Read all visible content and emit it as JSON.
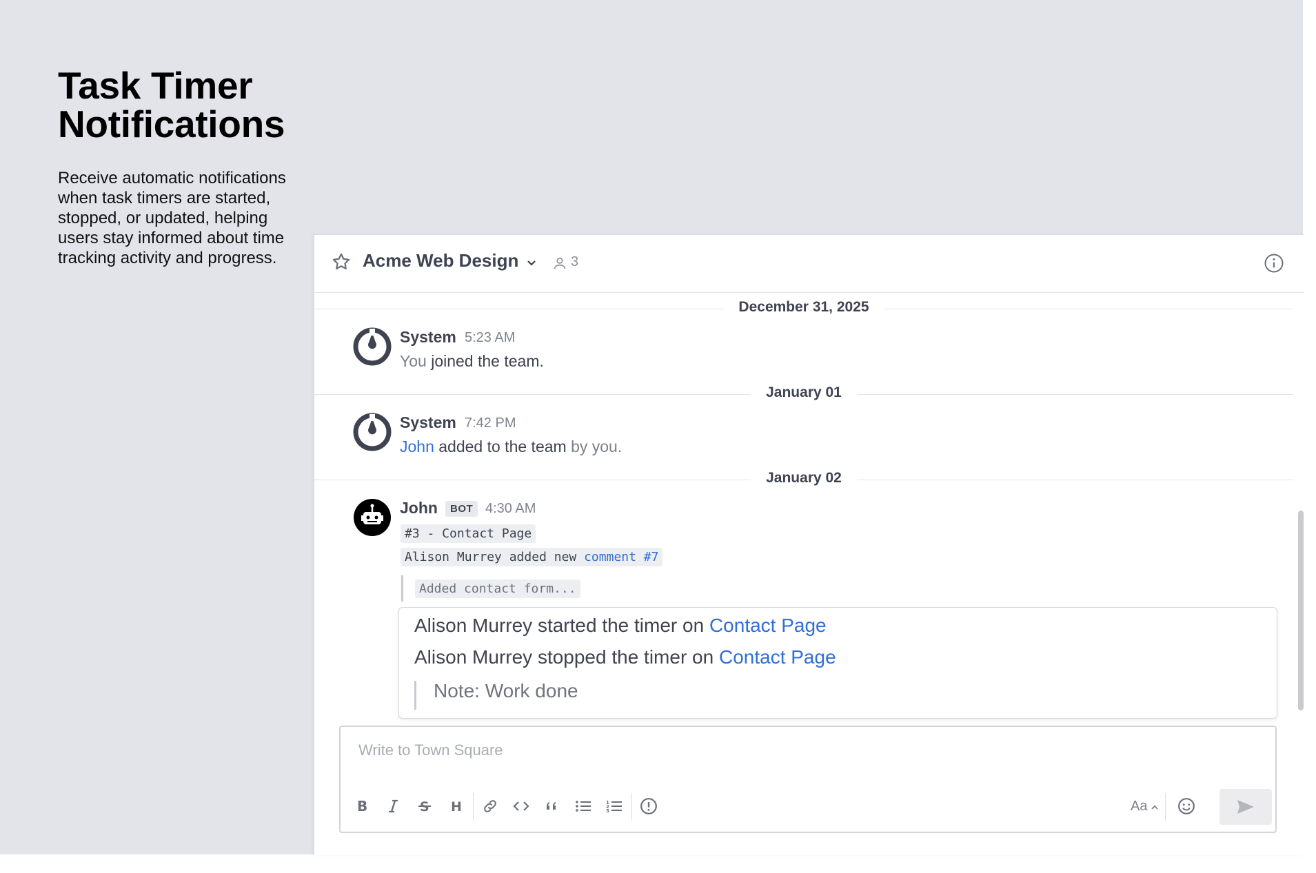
{
  "intro": {
    "title_line1": "Task Timer",
    "title_line2": "Notifications",
    "description": "Receive automatic notifications when task timers are started, stopped, or updated, helping users stay informed about time tracking activity and progress."
  },
  "channel": {
    "name": "Acme Web Design",
    "member_count": "3"
  },
  "dates": {
    "d1": "December 31, 2025",
    "d2": "January 01",
    "d3": "January 02"
  },
  "messages": {
    "m1": {
      "author": "System",
      "time": "5:23 AM",
      "you": "You",
      "text": " joined the team."
    },
    "m2": {
      "author": "System",
      "time": "7:42 PM",
      "mention": "John",
      "text": " added to the team",
      "suffix": " by you."
    },
    "m3": {
      "author": "John",
      "badge": "BOT",
      "time": "4:30 AM",
      "task_link": "#3 - Contact Page",
      "comment_prefix": "Alison Murrey added new ",
      "comment_link": "comment #7",
      "quote": "Added contact form..."
    }
  },
  "attachment": {
    "line1_text": "Alison Murrey started the timer on ",
    "line1_link": "Contact Page",
    "line2_text": "Alison Murrey stopped the timer on ",
    "line2_link": "Contact Page",
    "note": "Note: Work done"
  },
  "composer": {
    "placeholder": "Write to Town Square",
    "format_label": "Aa"
  },
  "colors": {
    "link": "#2f6fd6",
    "text": "#3f4350",
    "background": "#e3e3ea"
  }
}
